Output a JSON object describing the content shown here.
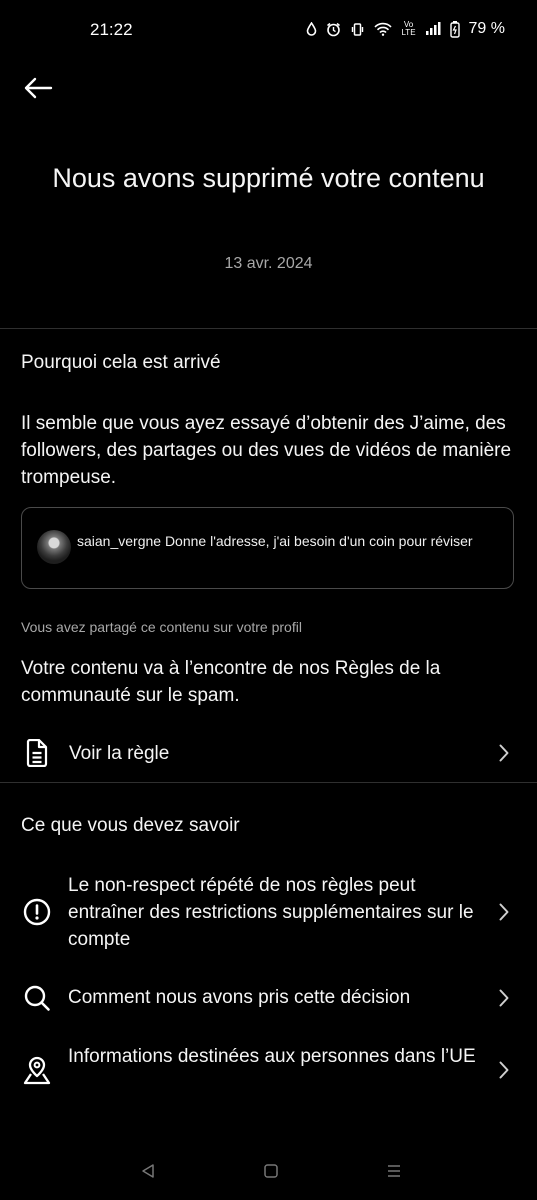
{
  "status_bar": {
    "time": "21:22",
    "network_top": "Vo",
    "network_bottom": "LTE",
    "battery_percent": "79 %"
  },
  "header": {
    "title": "Nous avons supprimé votre contenu",
    "date": "13 avr. 2024"
  },
  "why_section": {
    "heading": "Pourquoi cela est arrivé",
    "reason": "Il semble que vous ayez essayé d’obtenir des J’aime, des followers, des partages ou des vues de vidéos de manière trompeuse.",
    "content_preview": {
      "text": "saian_vergne Donne l'adresse, j'ai besoin d'un coin pour réviser"
    },
    "shared_note": "Vous avez partagé ce contenu sur votre profil",
    "violation": "Votre contenu va à l’encontre de nos Règles de la communauté sur le spam.",
    "rule_link": {
      "label": "Voir la règle",
      "icon": "document-icon"
    }
  },
  "know_section": {
    "heading": "Ce que vous devez savoir",
    "items": [
      {
        "label": "Le non-respect répété de nos règles peut entraîner des restrictions supplémentaires sur le compte",
        "icon": "exclamation-circle-icon"
      },
      {
        "label": "Comment nous avons pris cette décision",
        "icon": "search-icon"
      },
      {
        "label": "Informations destinées aux personnes dans l’UE",
        "icon": "location-pin-icon"
      }
    ]
  },
  "colors": {
    "background": "#000000",
    "text": "#f5f5f5",
    "muted_text": "#a8a8a8",
    "divider": "#2f2f2f",
    "card_border": "#4a4a4a"
  }
}
